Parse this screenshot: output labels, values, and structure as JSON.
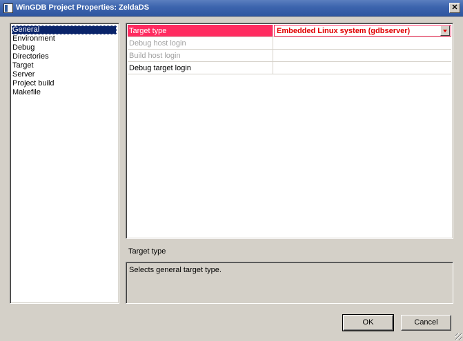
{
  "window": {
    "title": "WinGDB Project Properties: ZeldaDS",
    "close_glyph": "✕",
    "icon": "app-window-icon"
  },
  "nav": {
    "items": [
      {
        "label": "General",
        "selected": true
      },
      {
        "label": "Environment"
      },
      {
        "label": "Debug"
      },
      {
        "label": "Directories"
      },
      {
        "label": "Target"
      },
      {
        "label": "Server"
      },
      {
        "label": "Project build"
      },
      {
        "label": "Makefile"
      }
    ]
  },
  "properties": {
    "rows": [
      {
        "name": "Target type",
        "value": "Embedded Linux system (gdbserver)",
        "selected": true
      },
      {
        "name": "Debug host login",
        "value": "",
        "disabled": true
      },
      {
        "name": "Build host login",
        "value": "",
        "disabled": true
      },
      {
        "name": "Debug target login",
        "value": ""
      }
    ]
  },
  "description": {
    "title": "Target type",
    "text": "Selects general target type."
  },
  "buttons": {
    "ok": "OK",
    "cancel": "Cancel"
  },
  "colors": {
    "title_bar": "#3c64ad",
    "selected_row": "#ff2b60",
    "selected_value_text": "#e00000",
    "nav_selection": "#0a246a"
  }
}
